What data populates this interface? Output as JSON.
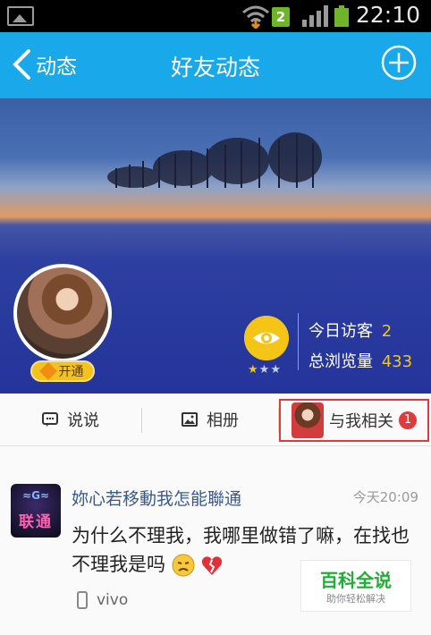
{
  "status_bar": {
    "sim_number": "2",
    "time": "22:10"
  },
  "header": {
    "back_label": "动态",
    "title": "好友动态"
  },
  "cover": {
    "stats": [
      {
        "label": "今日访客",
        "value": "2"
      },
      {
        "label": "总浏览量",
        "value": "433"
      }
    ],
    "vip_label": "开通",
    "star_level": 1,
    "star_count": 3
  },
  "tabs": {
    "shuoshuo": "说说",
    "album": "相册",
    "related": "与我相关",
    "related_badge": "1"
  },
  "post": {
    "avatar_text": "联通",
    "author": "妳心若移動我怎能聯通",
    "time": "今天20:09",
    "text": "为什么不理我，我哪里做错了嘛，在找也不理我是吗",
    "device": "vivo"
  },
  "watermark": {
    "title": "百科全说",
    "subtitle": "助你轻松解决"
  },
  "colors": {
    "header_bg": "#19a8e9",
    "accent_yellow": "#f4c417",
    "badge_red": "#e03a3a",
    "name_blue": "#3a5a8c"
  }
}
